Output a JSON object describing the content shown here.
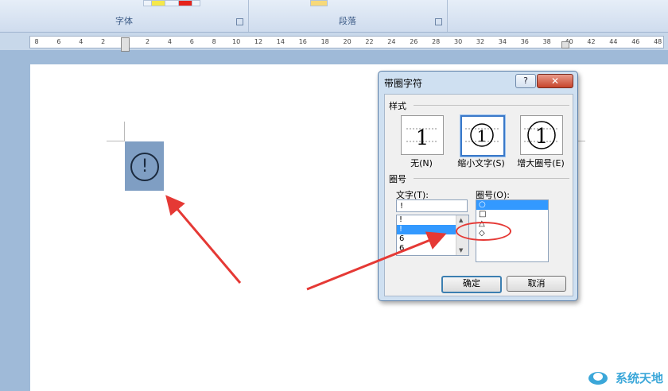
{
  "ribbon": {
    "group_font_label": "字体",
    "group_paragraph_label": "段落"
  },
  "ruler": {
    "ticks": [
      "8",
      "6",
      "4",
      "2",
      "",
      "2",
      "4",
      "6",
      "8",
      "10",
      "12",
      "14",
      "16",
      "18",
      "20",
      "22",
      "24",
      "26",
      "28",
      "30",
      "32",
      "34",
      "36",
      "38",
      "40",
      "42",
      "44",
      "46",
      "48"
    ]
  },
  "document": {
    "circled_glyph": "!"
  },
  "dialog": {
    "title": "带圈字符",
    "help_label": "?",
    "close_label": "✕",
    "style_section": "样式",
    "style_options": [
      {
        "label": "无(N)",
        "sample": "1"
      },
      {
        "label": "缩小文字(S)",
        "sample": "1"
      },
      {
        "label": "增大圈号(E)",
        "sample": "1"
      }
    ],
    "circle_section": "圈号",
    "text_label": "文字(T):",
    "text_value": "!",
    "text_list": [
      "!",
      "!",
      "6",
      "6"
    ],
    "text_list_selected": 1,
    "enclosure_label": "圈号(O):",
    "enclosure_list": [
      "○",
      "□",
      "△",
      "◇"
    ],
    "enclosure_selected": 0,
    "ok_label": "确定",
    "cancel_label": "取消"
  },
  "watermark": {
    "text": "系统天地"
  },
  "colors": {
    "annotation": "#e53935",
    "selection": "#3399ff"
  }
}
